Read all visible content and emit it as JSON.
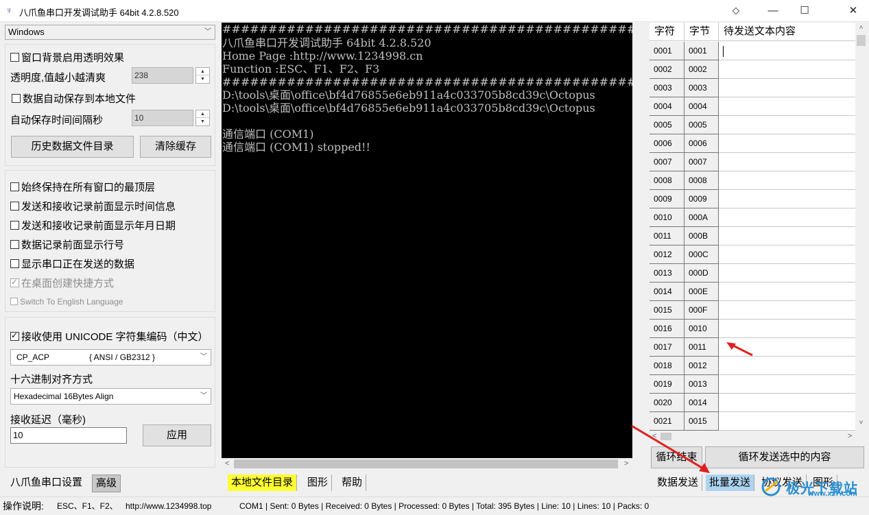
{
  "window": {
    "title": "八爪鱼串口开发调试助手 64bit 4.2.8.520",
    "pin_glyph": "⬦",
    "minimize_glyph": "—",
    "maximize_glyph": "☐",
    "close_glyph": "✕"
  },
  "left": {
    "style_select": "Windows",
    "transparency_checkbox": "窗口背景启用透明效果",
    "transparency_label": "透明度,值越小越清爽",
    "transparency_value": "238",
    "autosave_checkbox": "数据自动保存到本地文件",
    "autosave_interval_label": "自动保存时间间隔秒",
    "autosave_interval_value": "10",
    "history_button": "历史数据文件目录",
    "clear_cache_button": "清除缓存",
    "options": [
      {
        "label": "始终保持在所有窗口的最顶层",
        "checked": false,
        "disabled": false
      },
      {
        "label": "发送和接收记录前面显示时间信息",
        "checked": false,
        "disabled": false
      },
      {
        "label": "发送和接收记录前面显示年月日期",
        "checked": false,
        "disabled": false
      },
      {
        "label": "数据记录前面显示行号",
        "checked": false,
        "disabled": false
      },
      {
        "label": "显示串口正在发送的数据",
        "checked": false,
        "disabled": false
      },
      {
        "label": "在桌面创建快捷方式",
        "checked": true,
        "disabled": true
      },
      {
        "label": "Switch To English Language",
        "checked": false,
        "disabled": true
      }
    ],
    "unicode_checkbox": "接收使用 UNICODE 字符集编码（中文）",
    "codepage_select": "CP_ACP",
    "codepage_select_detail": "{ ANSI / GB2312  }",
    "hex_align_label": "十六进制对齐方式",
    "hex_align_select": "Hexadecimal 16Bytes Align",
    "recv_delay_label": "接收延迟（毫秒)",
    "recv_delay_value": "10",
    "apply_button": "应用",
    "tabs": [
      "八爪鱼串口设置",
      "高级"
    ]
  },
  "console": {
    "lines": [
      "#####################################################",
      "八爪鱼串口开发调试助手 64bit 4.2.8.520",
      "Home Page :http://www.1234998.cn",
      "Function  :ESC、F1、F2、F3",
      "#####################################################",
      "D:\\tools\\桌面\\office\\bf4d76855e6eb911a4c033705b8cd39c\\Octopus",
      "D:\\tools\\桌面\\office\\bf4d76855e6eb911a4c033705b8cd39c\\Octopus",
      "",
      "通信端口 (COM1)",
      "通信端口 (COM1) stopped!!"
    ],
    "tabs": [
      "本地文件目录",
      "图形",
      "帮助"
    ]
  },
  "send_grid": {
    "headers": [
      "字符",
      "字节",
      "待发送文本内容"
    ],
    "rows": [
      [
        "0001",
        "0001"
      ],
      [
        "0002",
        "0002"
      ],
      [
        "0003",
        "0003"
      ],
      [
        "0004",
        "0004"
      ],
      [
        "0005",
        "0005"
      ],
      [
        "0006",
        "0006"
      ],
      [
        "0007",
        "0007"
      ],
      [
        "0008",
        "0008"
      ],
      [
        "0009",
        "0009"
      ],
      [
        "0010",
        "000A"
      ],
      [
        "0011",
        "000B"
      ],
      [
        "0012",
        "000C"
      ],
      [
        "0013",
        "000D"
      ],
      [
        "0014",
        "000E"
      ],
      [
        "0015",
        "000F"
      ],
      [
        "0016",
        "0010"
      ],
      [
        "0017",
        "0011"
      ],
      [
        "0018",
        "0012"
      ],
      [
        "0019",
        "0013"
      ],
      [
        "0020",
        "0014"
      ],
      [
        "0021",
        "0015"
      ]
    ],
    "loop_end_button": "循环结束",
    "loop_send_button": "循环发送选中的内容",
    "tabs": [
      "数据发送",
      "批量发送",
      "协议发送",
      "图形"
    ]
  },
  "status_bar": {
    "ops_label": "操作说明:",
    "keys": "ESC、F1、F2、",
    "url": "http://www.1234998.top",
    "port": "COM1 | Sent: 0 Bytes | Received: 0 Bytes | Processed: 0 Bytes | Total: 395 Bytes | Line: 10 | Lines: 10 | Packs: 0"
  },
  "watermark": {
    "text": "极光下载站",
    "url": "www.xz7.com"
  },
  "colors": {
    "console_bg": "#000000",
    "console_text": "#c0c0c0",
    "tab_yellow": "#ffff33",
    "tab_blue": "#add4f0",
    "arrow_red": "#e02020"
  }
}
